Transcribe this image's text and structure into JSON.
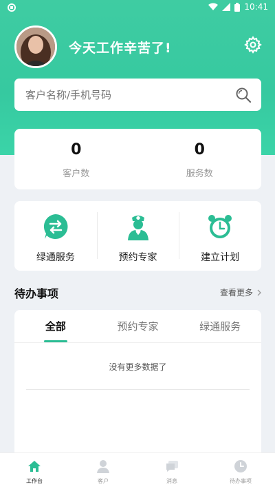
{
  "status_bar": {
    "time": "10:41"
  },
  "header": {
    "greeting": "今天工作辛苦了!"
  },
  "search": {
    "placeholder": "客户名称/手机号码"
  },
  "stats": [
    {
      "value": "0",
      "label": "客户数"
    },
    {
      "value": "0",
      "label": "服务数"
    }
  ],
  "actions": [
    {
      "label": "绿通服务",
      "icon": "swap-arrows-icon"
    },
    {
      "label": "预约专家",
      "icon": "doctor-icon"
    },
    {
      "label": "建立计划",
      "icon": "alarm-clock-icon"
    }
  ],
  "todo": {
    "title": "待办事项",
    "more_label": "查看更多",
    "tabs": [
      "全部",
      "预约专家",
      "绿通服务"
    ],
    "active_tab": "全部",
    "empty_text": "没有更多数据了"
  },
  "tabbar": [
    {
      "label": "工作台",
      "icon": "home-icon",
      "active": true
    },
    {
      "label": "客户",
      "icon": "user-icon",
      "active": false
    },
    {
      "label": "消息",
      "icon": "message-icon",
      "active": false
    },
    {
      "label": "待办事项",
      "icon": "clock-icon",
      "active": false
    }
  ],
  "colors": {
    "primary": "#36c9a0",
    "icon_green": "#2bbd94",
    "background": "#eef1f5"
  }
}
